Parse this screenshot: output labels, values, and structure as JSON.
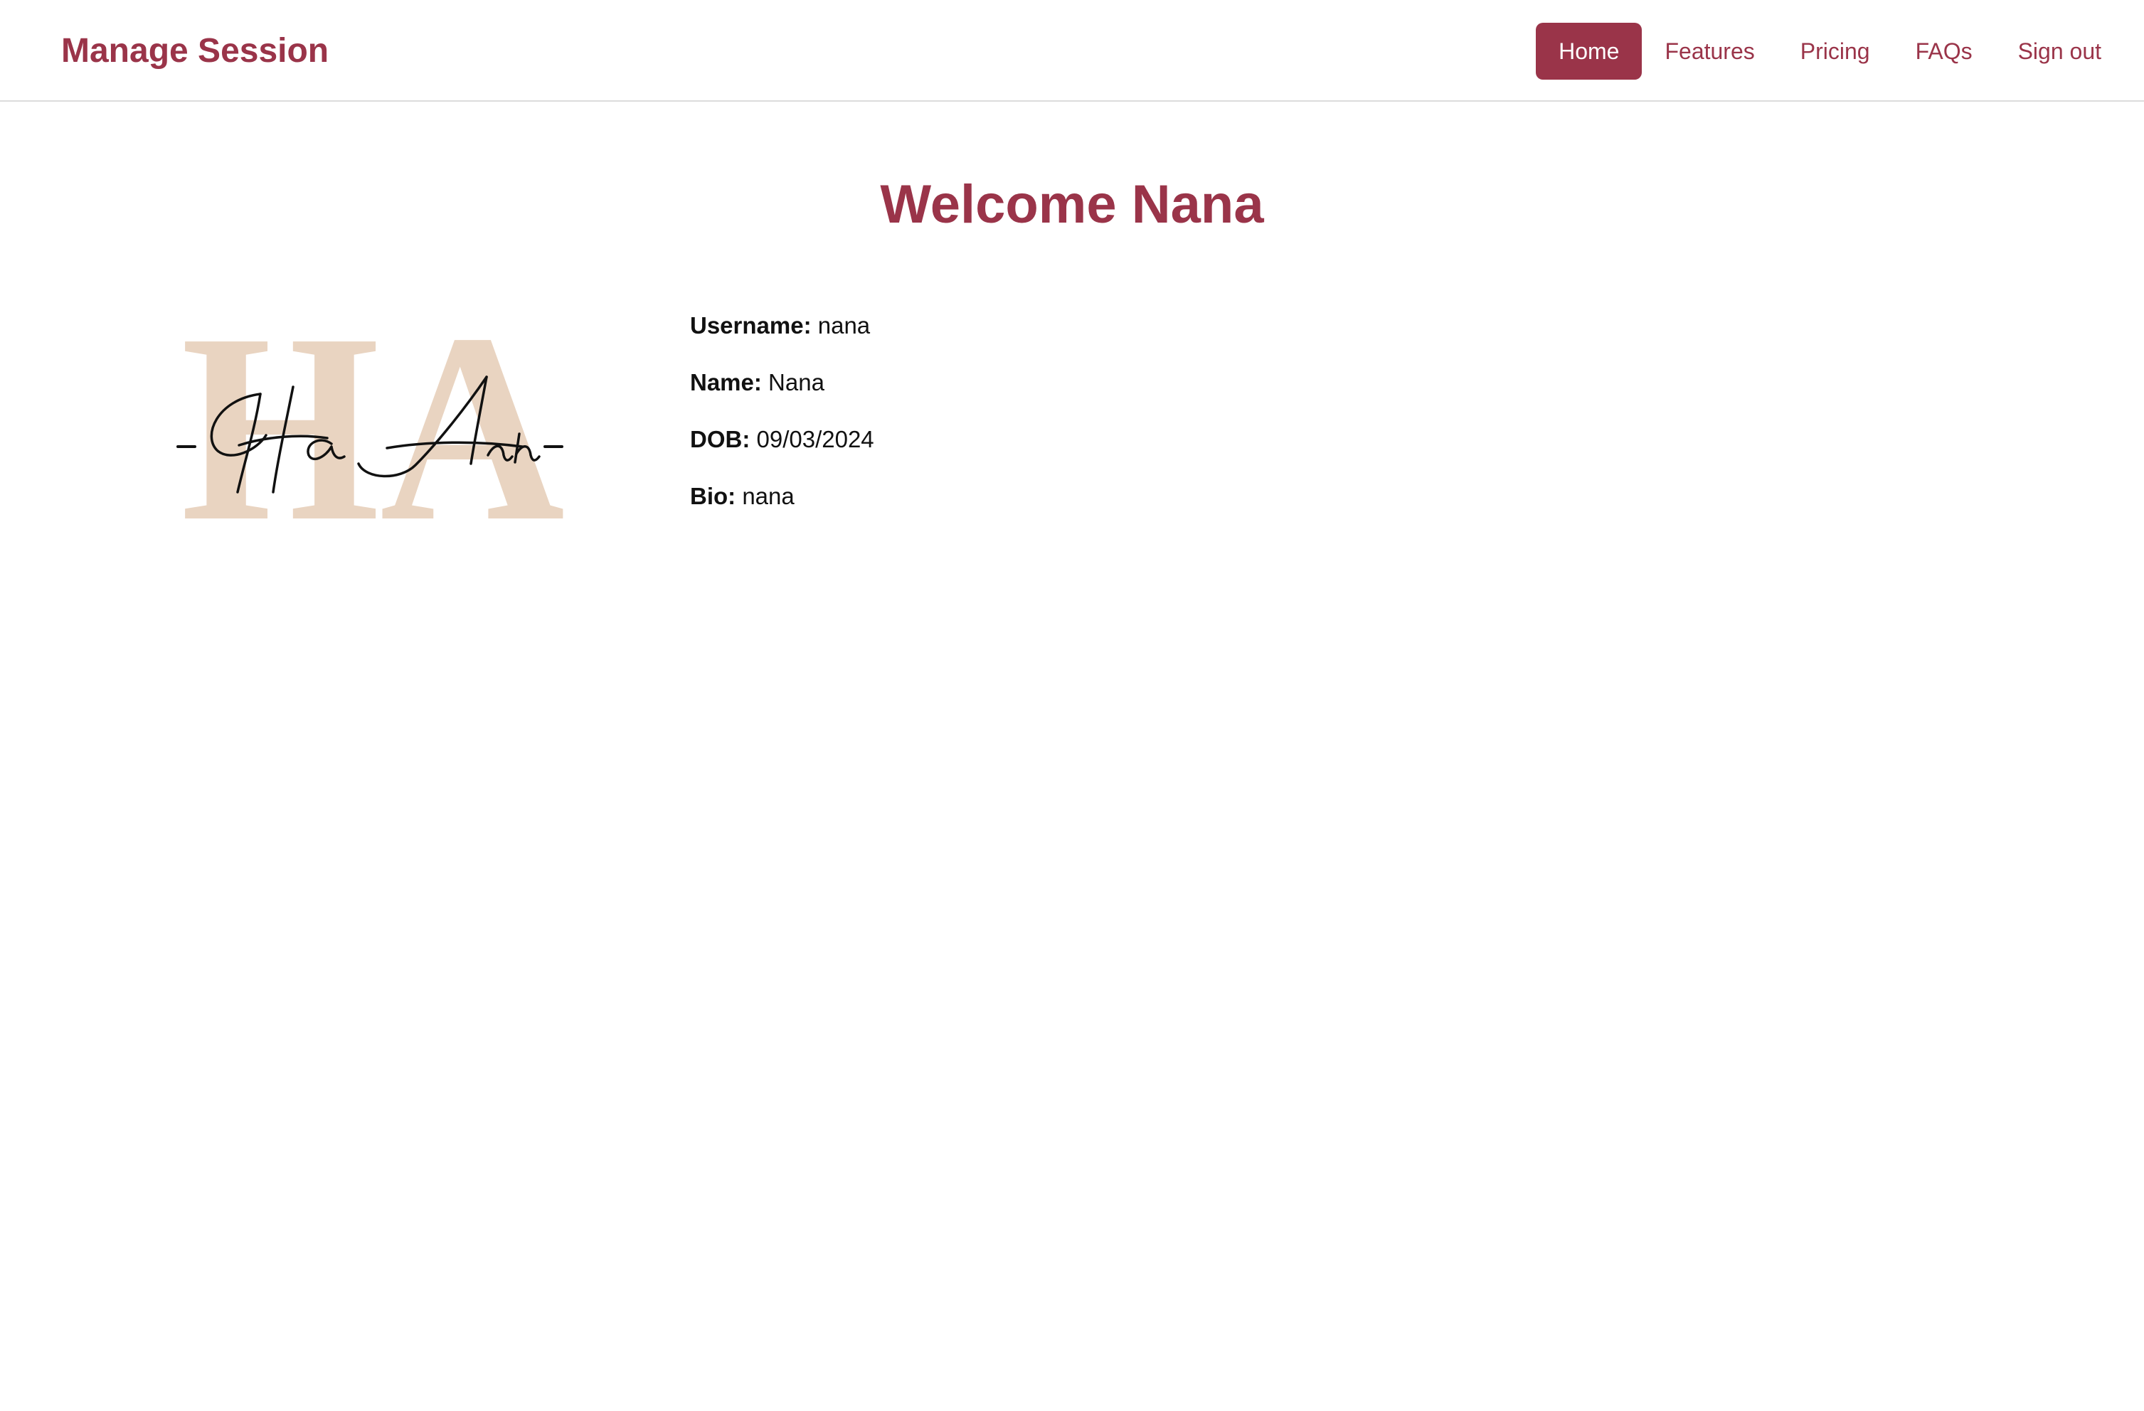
{
  "nav": {
    "brand": "Manage Session",
    "items": [
      {
        "label": "Home",
        "active": true
      },
      {
        "label": "Features",
        "active": false
      },
      {
        "label": "Pricing",
        "active": false
      },
      {
        "label": "FAQs",
        "active": false
      },
      {
        "label": "Sign out",
        "active": false
      }
    ]
  },
  "main": {
    "heading": "Welcome Nana",
    "logo": {
      "monogram": "HA",
      "script": "Ha Anh"
    },
    "profile": [
      {
        "label": "Username:",
        "value": "nana"
      },
      {
        "label": "Name:",
        "value": "Nana"
      },
      {
        "label": "DOB:",
        "value": "09/03/2024"
      },
      {
        "label": "Bio:",
        "value": "nana"
      }
    ]
  },
  "colors": {
    "accent": "#9a3449",
    "monogram": "#e9d4c1",
    "border": "#dcdcdc"
  }
}
